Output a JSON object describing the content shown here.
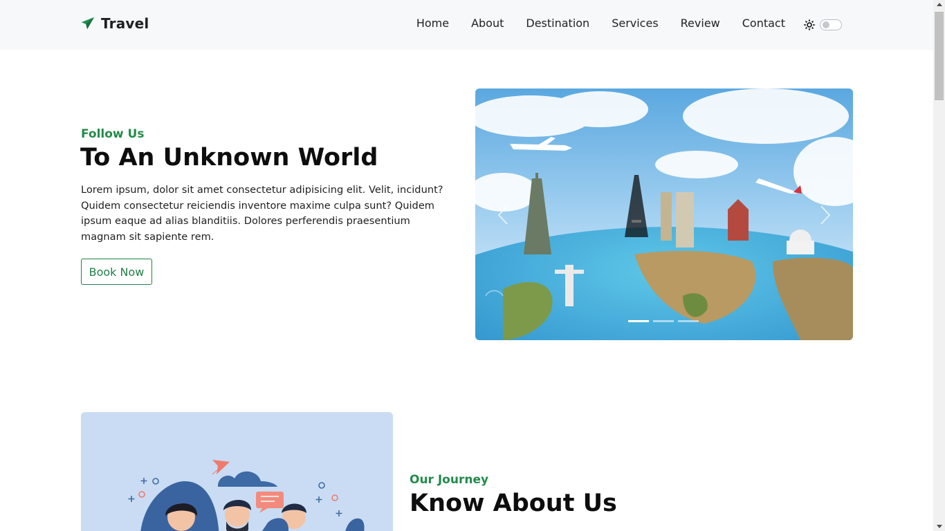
{
  "brand": {
    "name": "Travel",
    "icon": "paper-plane-icon",
    "color": "#1e8c4e"
  },
  "nav": {
    "links": [
      "Home",
      "About",
      "Destination",
      "Services",
      "Review",
      "Contact"
    ],
    "theme_icon": "sun-icon",
    "theme_toggle_on": false
  },
  "hero": {
    "subtitle": "Follow Us",
    "title": "To An Unknown World",
    "text": "Lorem ipsum, dolor sit amet consectetur adipisicing elit. Velit, incidunt? Quidem consectetur reiciendis inventore maxime culpa sunt? Quidem ipsum eaque ad alias blanditiis. Dolores perferendis praesentium magnam sit sapiente rem.",
    "button": "Book Now"
  },
  "carousel": {
    "prev_icon": "chevron-left-icon",
    "next_icon": "chevron-right-icon",
    "slide_count": 3,
    "active_slide": 1
  },
  "about": {
    "subtitle": "Our Journey",
    "title": "Know About Us"
  },
  "colors": {
    "accent": "#228b4a",
    "navbar_bg": "#f7f8fa",
    "about_card_bg": "#c9dcf3"
  }
}
